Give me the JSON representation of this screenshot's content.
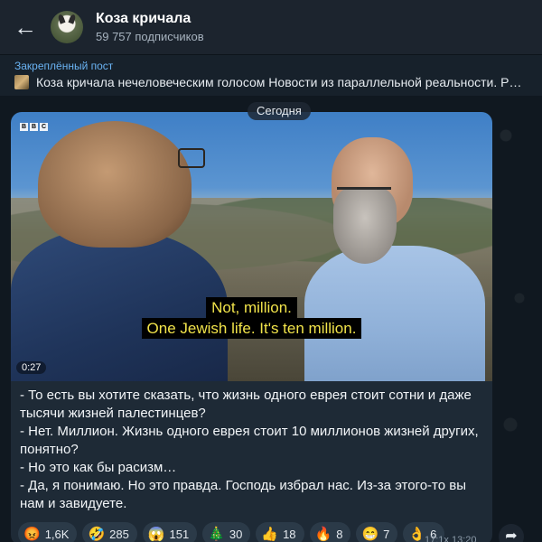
{
  "header": {
    "title": "Коза кричала",
    "subscribers": "59 757 подписчиков"
  },
  "pinned": {
    "label": "Закреплённый пост",
    "text": "Коза кричала нечеловеческим голосом Новости из параллельной реальности. Рж..."
  },
  "date_divider": "Сегодня",
  "video": {
    "logo": [
      "B",
      "B",
      "C"
    ],
    "subtitle_line1": "Not, million.",
    "subtitle_line2": "One Jewish life. It's ten million.",
    "duration": "0:27"
  },
  "message": {
    "lines": [
      "- То есть вы хотите сказать, что жизнь одного еврея стоит сотни и даже тысячи жизней палестинцев?",
      "- Нет. Миллион. Жизнь одного еврея стоит 10 миллионов жизней других, понятно?",
      "- Но это как бы расизм…",
      "- Да, я понимаю. Но это правда. Господь избрал нас. Из-за этого-то вы нам и завидуете."
    ],
    "time": "17:1x 13:20"
  },
  "reactions": [
    {
      "emoji": "😡",
      "count": "1,6K"
    },
    {
      "emoji": "🤣",
      "count": "285"
    },
    {
      "emoji": "😱",
      "count": "151"
    },
    {
      "emoji": "🎄",
      "count": "30"
    },
    {
      "emoji": "👍",
      "count": "18"
    },
    {
      "emoji": "🔥",
      "count": "8"
    },
    {
      "emoji": "😁",
      "count": "7"
    },
    {
      "emoji": "👌",
      "count": "6"
    }
  ],
  "colors": {
    "header_bg": "#1c242e",
    "accent": "#6ab3f3",
    "bubble_bg": "#1e2a36",
    "subtitle": "#f1e34a"
  },
  "icons": {
    "back": "arrow-left-icon",
    "share": "share-arrow-icon"
  }
}
